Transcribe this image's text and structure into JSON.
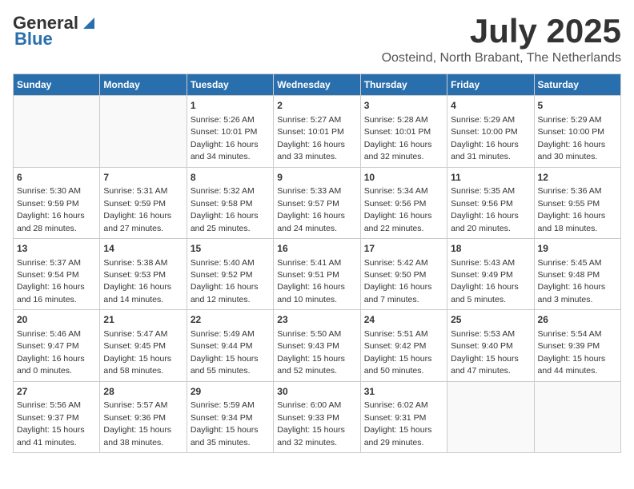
{
  "header": {
    "logo_line1": "General",
    "logo_line2": "Blue",
    "month_year": "July 2025",
    "location": "Oosteind, North Brabant, The Netherlands"
  },
  "weekdays": [
    "Sunday",
    "Monday",
    "Tuesday",
    "Wednesday",
    "Thursday",
    "Friday",
    "Saturday"
  ],
  "weeks": [
    [
      null,
      null,
      {
        "day": 1,
        "sunrise": "5:26 AM",
        "sunset": "10:01 PM",
        "daylight": "16 hours and 34 minutes."
      },
      {
        "day": 2,
        "sunrise": "5:27 AM",
        "sunset": "10:01 PM",
        "daylight": "16 hours and 33 minutes."
      },
      {
        "day": 3,
        "sunrise": "5:28 AM",
        "sunset": "10:01 PM",
        "daylight": "16 hours and 32 minutes."
      },
      {
        "day": 4,
        "sunrise": "5:29 AM",
        "sunset": "10:00 PM",
        "daylight": "16 hours and 31 minutes."
      },
      {
        "day": 5,
        "sunrise": "5:29 AM",
        "sunset": "10:00 PM",
        "daylight": "16 hours and 30 minutes."
      }
    ],
    [
      {
        "day": 6,
        "sunrise": "5:30 AM",
        "sunset": "9:59 PM",
        "daylight": "16 hours and 28 minutes."
      },
      {
        "day": 7,
        "sunrise": "5:31 AM",
        "sunset": "9:59 PM",
        "daylight": "16 hours and 27 minutes."
      },
      {
        "day": 8,
        "sunrise": "5:32 AM",
        "sunset": "9:58 PM",
        "daylight": "16 hours and 25 minutes."
      },
      {
        "day": 9,
        "sunrise": "5:33 AM",
        "sunset": "9:57 PM",
        "daylight": "16 hours and 24 minutes."
      },
      {
        "day": 10,
        "sunrise": "5:34 AM",
        "sunset": "9:56 PM",
        "daylight": "16 hours and 22 minutes."
      },
      {
        "day": 11,
        "sunrise": "5:35 AM",
        "sunset": "9:56 PM",
        "daylight": "16 hours and 20 minutes."
      },
      {
        "day": 12,
        "sunrise": "5:36 AM",
        "sunset": "9:55 PM",
        "daylight": "16 hours and 18 minutes."
      }
    ],
    [
      {
        "day": 13,
        "sunrise": "5:37 AM",
        "sunset": "9:54 PM",
        "daylight": "16 hours and 16 minutes."
      },
      {
        "day": 14,
        "sunrise": "5:38 AM",
        "sunset": "9:53 PM",
        "daylight": "16 hours and 14 minutes."
      },
      {
        "day": 15,
        "sunrise": "5:40 AM",
        "sunset": "9:52 PM",
        "daylight": "16 hours and 12 minutes."
      },
      {
        "day": 16,
        "sunrise": "5:41 AM",
        "sunset": "9:51 PM",
        "daylight": "16 hours and 10 minutes."
      },
      {
        "day": 17,
        "sunrise": "5:42 AM",
        "sunset": "9:50 PM",
        "daylight": "16 hours and 7 minutes."
      },
      {
        "day": 18,
        "sunrise": "5:43 AM",
        "sunset": "9:49 PM",
        "daylight": "16 hours and 5 minutes."
      },
      {
        "day": 19,
        "sunrise": "5:45 AM",
        "sunset": "9:48 PM",
        "daylight": "16 hours and 3 minutes."
      }
    ],
    [
      {
        "day": 20,
        "sunrise": "5:46 AM",
        "sunset": "9:47 PM",
        "daylight": "16 hours and 0 minutes."
      },
      {
        "day": 21,
        "sunrise": "5:47 AM",
        "sunset": "9:45 PM",
        "daylight": "15 hours and 58 minutes."
      },
      {
        "day": 22,
        "sunrise": "5:49 AM",
        "sunset": "9:44 PM",
        "daylight": "15 hours and 55 minutes."
      },
      {
        "day": 23,
        "sunrise": "5:50 AM",
        "sunset": "9:43 PM",
        "daylight": "15 hours and 52 minutes."
      },
      {
        "day": 24,
        "sunrise": "5:51 AM",
        "sunset": "9:42 PM",
        "daylight": "15 hours and 50 minutes."
      },
      {
        "day": 25,
        "sunrise": "5:53 AM",
        "sunset": "9:40 PM",
        "daylight": "15 hours and 47 minutes."
      },
      {
        "day": 26,
        "sunrise": "5:54 AM",
        "sunset": "9:39 PM",
        "daylight": "15 hours and 44 minutes."
      }
    ],
    [
      {
        "day": 27,
        "sunrise": "5:56 AM",
        "sunset": "9:37 PM",
        "daylight": "15 hours and 41 minutes."
      },
      {
        "day": 28,
        "sunrise": "5:57 AM",
        "sunset": "9:36 PM",
        "daylight": "15 hours and 38 minutes."
      },
      {
        "day": 29,
        "sunrise": "5:59 AM",
        "sunset": "9:34 PM",
        "daylight": "15 hours and 35 minutes."
      },
      {
        "day": 30,
        "sunrise": "6:00 AM",
        "sunset": "9:33 PM",
        "daylight": "15 hours and 32 minutes."
      },
      {
        "day": 31,
        "sunrise": "6:02 AM",
        "sunset": "9:31 PM",
        "daylight": "15 hours and 29 minutes."
      },
      null,
      null
    ]
  ]
}
